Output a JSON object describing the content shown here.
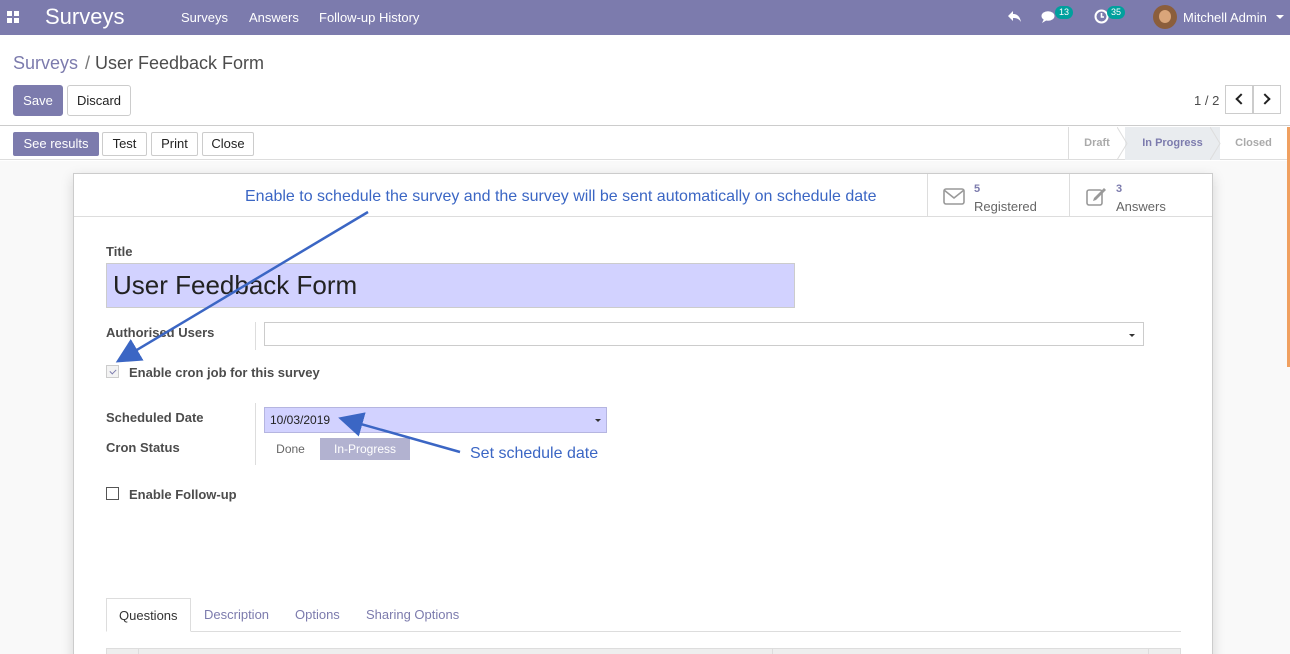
{
  "navbar": {
    "app_name": "Surveys",
    "menu": [
      "Surveys",
      "Answers",
      "Follow-up History"
    ],
    "messages_count": "13",
    "activities_count": "35",
    "user_name": "Mitchell Admin",
    "color": "#7c7bad"
  },
  "breadcrumb": {
    "parent": "Surveys",
    "separator": "/",
    "current": "User Feedback Form"
  },
  "controls": {
    "save_label": "Save",
    "discard_label": "Discard",
    "pager": "1 / 2"
  },
  "header": {
    "buttons": [
      "See results",
      "Test",
      "Print",
      "Close"
    ],
    "stages": [
      "Draft",
      "In Progress",
      "Closed"
    ],
    "active_stage": "In Progress"
  },
  "stats": {
    "registered_count": "5",
    "registered_label": "Registered",
    "answers_count": "3",
    "answers_label": "Answers"
  },
  "form": {
    "title_label": "Title",
    "title_value": "User Feedback Form",
    "authorised_users_label": "Authorised Users",
    "authorised_users_value": "",
    "cron_label": "Enable cron job for this survey",
    "cron_checked": true,
    "scheduled_date_label": "Scheduled Date",
    "scheduled_date_value": "10/03/2019",
    "cron_status_label": "Cron Status",
    "cron_status_options": [
      "Done",
      "In-Progress"
    ],
    "cron_status_selected": "In-Progress",
    "followup_label": "Enable Follow-up",
    "followup_checked": false
  },
  "tabs": [
    "Questions",
    "Description",
    "Options",
    "Sharing Options"
  ],
  "active_tab": "Questions",
  "annotations": {
    "top": "Enable to schedule the survey and the survey will be sent automatically on schedule date",
    "date": "Set schedule date",
    "color": "#3b66c4"
  }
}
